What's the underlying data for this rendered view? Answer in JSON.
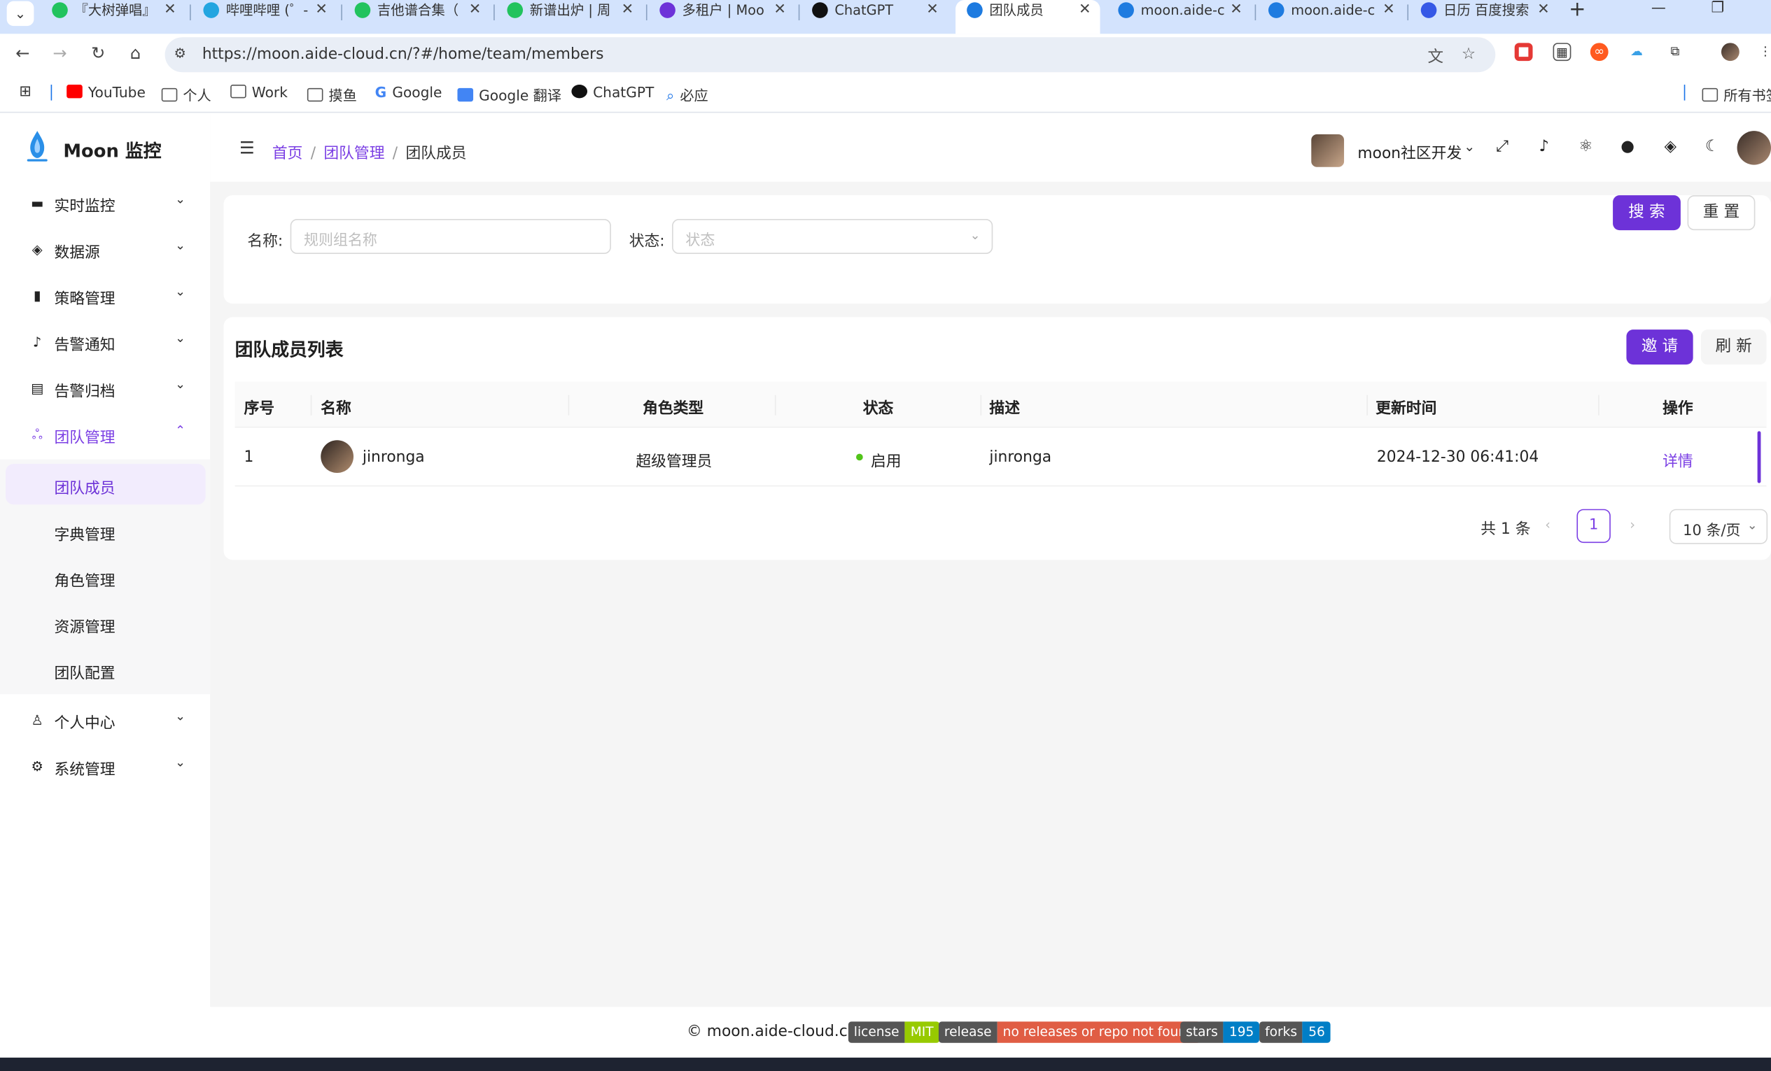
{
  "browser": {
    "tabs": [
      {
        "title": "『大树弹唱』",
        "icon_color": "#22c35e"
      },
      {
        "title": "哔哩哔哩 (゜-",
        "icon_color": "#23a5e0"
      },
      {
        "title": "吉他谱合集（",
        "icon_color": "#22c35e"
      },
      {
        "title": "新谱出炉 | 周",
        "icon_color": "#22c35e"
      },
      {
        "title": "多租户 | Moo",
        "icon_color": "#6d32d8"
      },
      {
        "title": "ChatGPT",
        "icon_color": "#111111"
      },
      {
        "title": "团队成员",
        "icon_color": "#1e7be0"
      },
      {
        "title": "moon.aide-c",
        "icon_color": "#1e7be0"
      },
      {
        "title": "moon.aide-c",
        "icon_color": "#1e7be0"
      },
      {
        "title": "日历 百度搜索",
        "icon_color": "#3558e6"
      }
    ],
    "url": "https://moon.aide-cloud.cn/?#/home/team/members",
    "bookmarks": [
      "YouTube",
      "个人",
      "Work",
      "摸鱼",
      "Google",
      "Google 翻译",
      "ChatGPT",
      "必应"
    ],
    "all_bookmarks": "所有书签"
  },
  "app": {
    "brand": "Moon 监控",
    "menu": [
      {
        "label": "实时监控",
        "icon": "monitor-icon"
      },
      {
        "label": "数据源",
        "icon": "layers-icon"
      },
      {
        "label": "策略管理",
        "icon": "policy-icon"
      },
      {
        "label": "告警通知",
        "icon": "bell-icon"
      },
      {
        "label": "告警归档",
        "icon": "archive-icon"
      },
      {
        "label": "团队管理",
        "icon": "team-icon"
      },
      {
        "label": "个人中心",
        "icon": "user-icon"
      },
      {
        "label": "系统管理",
        "icon": "settings-icon"
      }
    ],
    "submenu": [
      "团队成员",
      "字典管理",
      "角色管理",
      "资源管理",
      "团队配置"
    ],
    "breadcrumb": [
      "首页",
      "团队管理",
      "团队成员"
    ],
    "team_name": "moon社区开发"
  },
  "search": {
    "name_label": "名称:",
    "name_placeholder": "规则组名称",
    "status_label": "状态:",
    "status_placeholder": "状态",
    "search_btn": "搜 索",
    "reset_btn": "重 置"
  },
  "table": {
    "title": "团队成员列表",
    "invite_btn": "邀 请",
    "refresh_btn": "刷 新",
    "columns": [
      "序号",
      "名称",
      "角色类型",
      "状态",
      "描述",
      "更新时间",
      "操作"
    ],
    "rows": [
      {
        "index": "1",
        "name": "jinronga",
        "role": "超级管理员",
        "status": "启用",
        "desc": "jinronga",
        "updated": "2024-12-30 06:41:04",
        "action": "详情"
      }
    ],
    "total": "共 1 条",
    "page": "1",
    "page_size": "10 条/页"
  },
  "footer": {
    "copyright": "moon.aide-cloud.cn",
    "badges": [
      {
        "key": "license",
        "value": "MIT",
        "color": "#97ca00"
      },
      {
        "key": "release",
        "value": "no releases or repo not found",
        "color": "#e05d44"
      },
      {
        "key": "stars",
        "value": "195",
        "color": "#007ec6"
      },
      {
        "key": "forks",
        "value": "56",
        "color": "#007ec6"
      }
    ]
  },
  "colors": {
    "primary": "#6d32d8",
    "tab_strip": "#d3e3fd",
    "status_ok": "#52c41a"
  }
}
